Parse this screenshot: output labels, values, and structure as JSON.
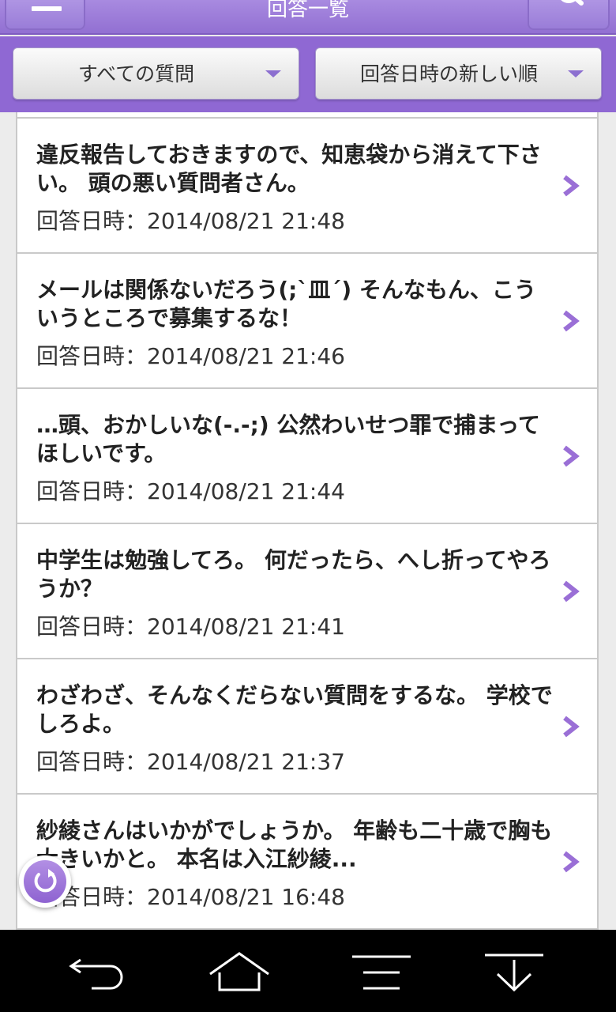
{
  "header": {
    "title": "回答一覧"
  },
  "filters": {
    "category": "すべての質問",
    "sort": "回答日時の新しい順"
  },
  "answers": [
    {
      "text": "違反報告しておきますので、知恵袋から消えて下さい。 頭の悪い質問者さん。",
      "date": "回答日時：2014/08/21 21:48"
    },
    {
      "text": "メールは関係ないだろう(;`皿´) そんなもん、こういうところで募集するな！",
      "date": "回答日時：2014/08/21 21:46"
    },
    {
      "text": "…頭、おかしいな(-.-;) 公然わいせつ罪で捕まってほしいです。",
      "date": "回答日時：2014/08/21 21:44"
    },
    {
      "text": "中学生は勉強してろ。 何だったら、へし折ってやろうか？",
      "date": "回答日時：2014/08/21 21:41"
    },
    {
      "text": "わざわざ、そんなくだらない質問をするな。 学校でしろよ。",
      "date": "回答日時：2014/08/21 21:37"
    },
    {
      "text": "紗綾さんはいかがでしょうか。 年齢も二十歳で胸も大きいかと。 本名は入江紗綾...",
      "date": "回答日時：2014/08/21 16:48"
    }
  ],
  "icons": {
    "menu": "menu-icon",
    "search": "search-icon",
    "chevron": "chevron-right-icon",
    "refresh": "refresh-icon",
    "back": "back-icon",
    "home": "home-icon",
    "nav_menu": "menu-lines-icon",
    "down": "download-icon"
  },
  "colors": {
    "header": "#9a78d8",
    "accent": "#9a6fd6"
  }
}
